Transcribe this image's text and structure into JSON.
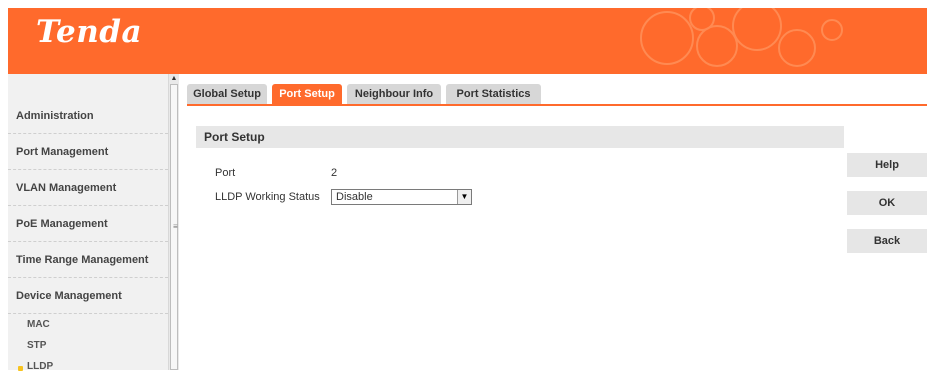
{
  "header": {
    "logo_text": "Tenda"
  },
  "sidebar": {
    "items": [
      {
        "label": "Administration"
      },
      {
        "label": "Port Management"
      },
      {
        "label": "VLAN Management"
      },
      {
        "label": "PoE Management"
      },
      {
        "label": "Time Range Management"
      },
      {
        "label": "Device Management"
      }
    ],
    "sub_items": [
      {
        "label": "MAC"
      },
      {
        "label": "STP"
      },
      {
        "label": "LLDP",
        "selected": true
      }
    ]
  },
  "tabs": [
    {
      "label": "Global Setup",
      "active": false
    },
    {
      "label": "Port Setup",
      "active": true
    },
    {
      "label": "Neighbour Info",
      "active": false
    },
    {
      "label": "Port Statistics",
      "active": false
    }
  ],
  "panel": {
    "title": "Port Setup",
    "port_label": "Port",
    "port_value": "2",
    "lldp_label": "LLDP Working Status",
    "lldp_selected": "Disable"
  },
  "buttons": {
    "help": "Help",
    "ok": "OK",
    "back": "Back"
  },
  "colors": {
    "accent": "#ff6a2c",
    "tab_inactive": "#d7d7d7",
    "sidebar_bg": "#f1f1f1",
    "bullet": "#f7c31f"
  }
}
